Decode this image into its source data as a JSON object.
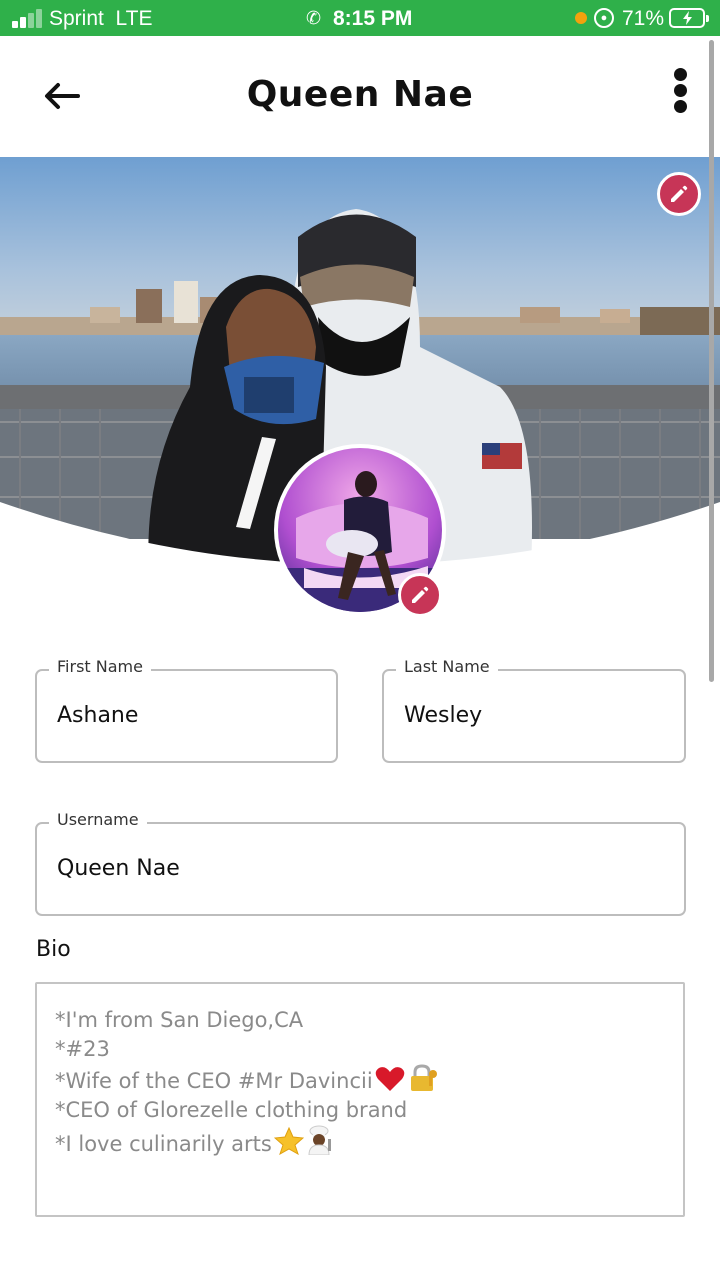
{
  "status_bar": {
    "carrier": "Sprint",
    "network": "LTE",
    "time": "8:15 PM",
    "battery": "71%",
    "battery_level": 0.71,
    "signal_bars": 2,
    "color": "#2fb04a"
  },
  "header": {
    "title": "Queen Nae",
    "back_icon": "arrow-left-icon",
    "menu_icon": "more-vertical-icon"
  },
  "profile": {
    "cover_edit_icon": "pencil-icon",
    "avatar_edit_icon": "pencil-icon",
    "accent_color": "#c73557"
  },
  "form": {
    "first_name": {
      "label": "First Name",
      "value": "Ashane"
    },
    "last_name": {
      "label": "Last Name",
      "value": "Wesley"
    },
    "username": {
      "label": "Username",
      "value": "Queen Nae"
    },
    "bio": {
      "label": "Bio",
      "lines": [
        "*I'm from San Diego,CA",
        "*#23",
        "*Wife of the CEO #Mr Davincii",
        "*CEO of Glorezelle clothing brand",
        "*I love culinarily arts"
      ]
    }
  }
}
